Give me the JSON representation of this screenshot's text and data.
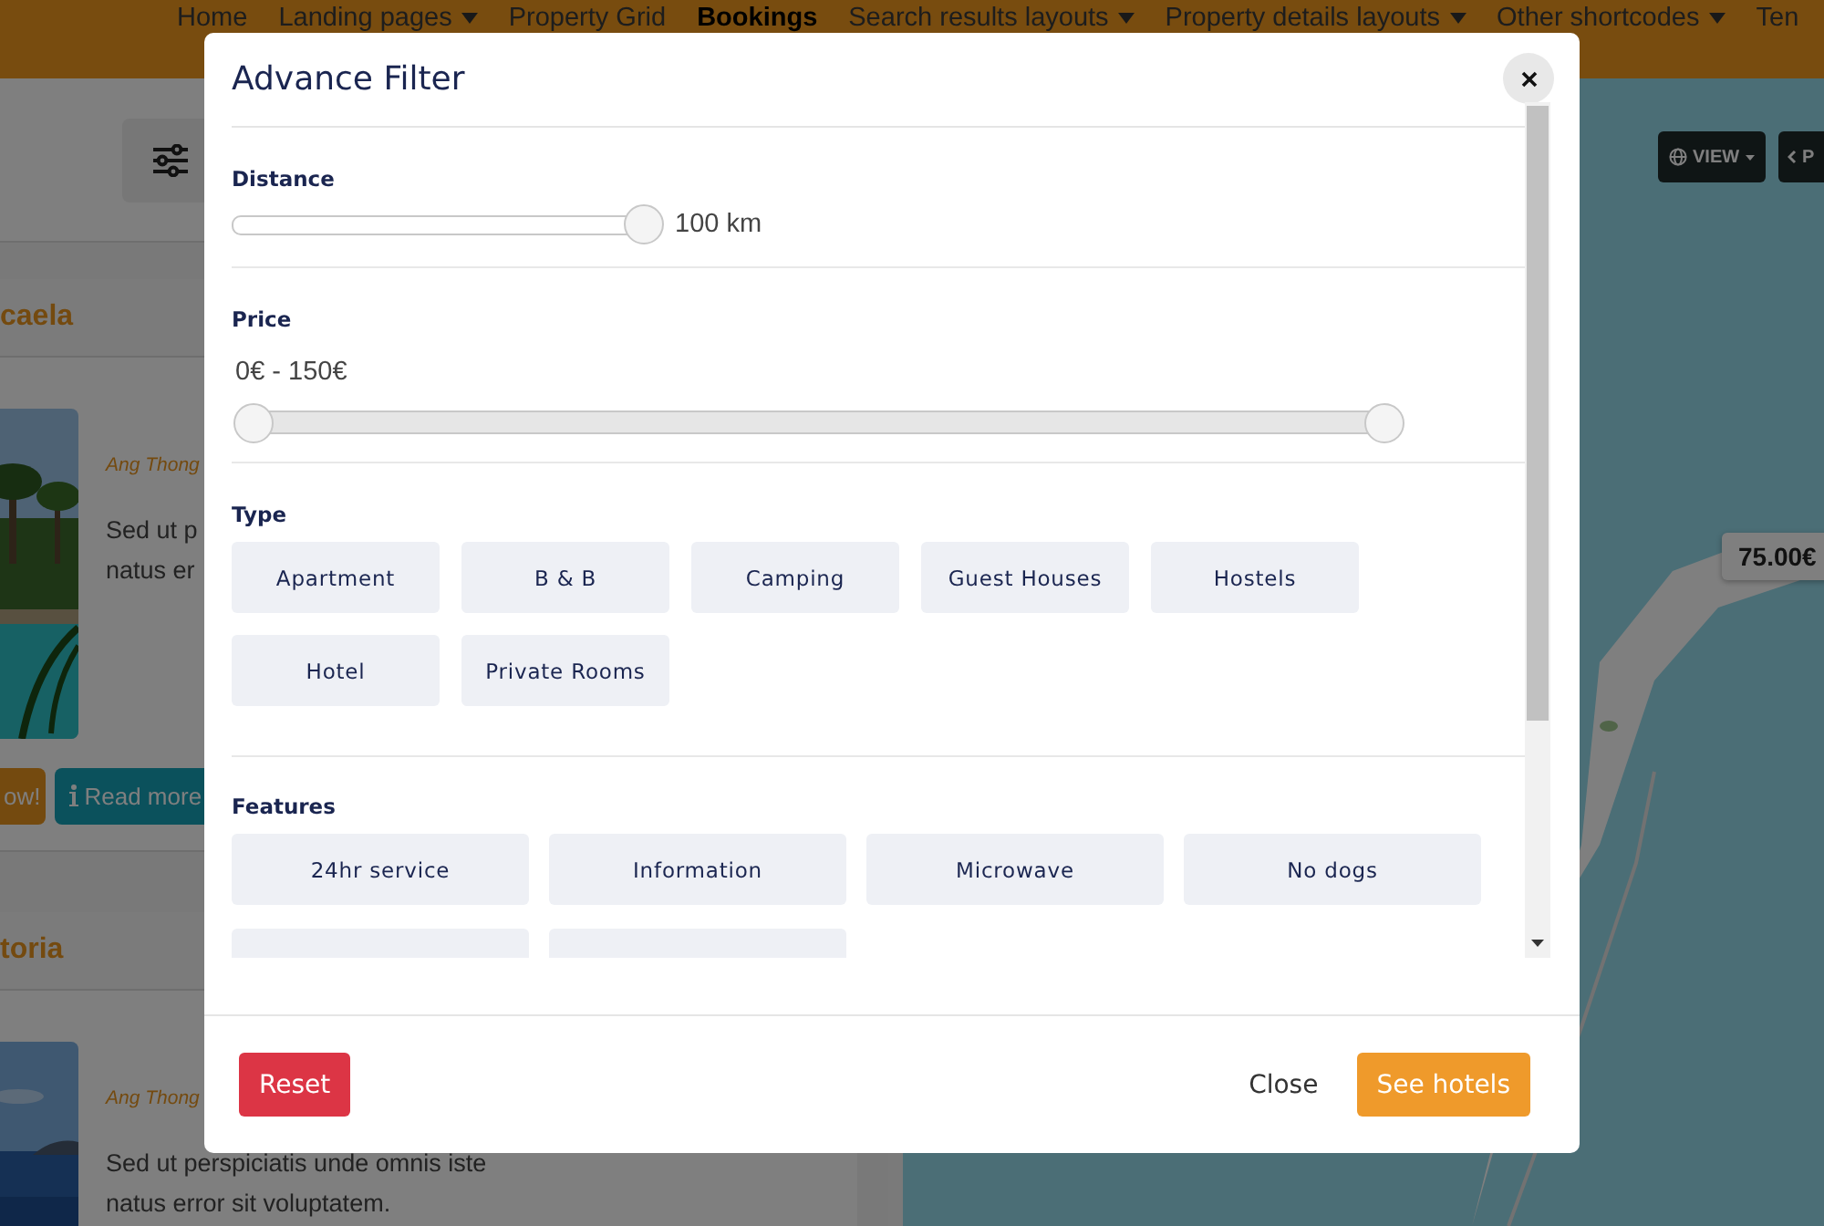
{
  "nav": {
    "items": [
      {
        "label": "Home",
        "has_menu": false,
        "selected": false
      },
      {
        "label": "Landing pages",
        "has_menu": true,
        "selected": false
      },
      {
        "label": "Property Grid",
        "has_menu": false,
        "selected": false
      },
      {
        "label": "Bookings",
        "has_menu": false,
        "selected": true
      },
      {
        "label": "Search results layouts",
        "has_menu": true,
        "selected": false
      },
      {
        "label": "Property details layouts",
        "has_menu": true,
        "selected": false
      },
      {
        "label": "Other shortcodes",
        "has_menu": true,
        "selected": false
      },
      {
        "label": "Ten",
        "has_menu": false,
        "selected": false
      }
    ]
  },
  "listings": [
    {
      "title": "caela",
      "location": "Ang Thong",
      "text_lines": [
        "Sed ut p",
        "natus er"
      ],
      "buttons": [
        {
          "label": "ow!",
          "kind": "book"
        },
        {
          "label": "Read more",
          "kind": "info"
        }
      ]
    },
    {
      "title": "toria",
      "location": "Ang Thong",
      "text_lines": [
        "Sed ut perspiciatis unde omnis iste",
        "natus error sit voluptatem."
      ]
    }
  ],
  "map": {
    "view_button": "VIEW",
    "prev_button": "P",
    "price_marker": "75.00€"
  },
  "modal": {
    "title": "Advance Filter",
    "sections": [
      {
        "kind": "slider",
        "label": "Distance",
        "level": 1,
        "reading": "100 km"
      },
      {
        "kind": "range",
        "label": "Price",
        "reading": "0€ - 150€",
        "handles": [
          {
            "level": 0
          },
          {
            "level": 1
          }
        ]
      },
      {
        "kind": "chips",
        "label": "Type",
        "options": [
          {
            "label": "Apartment",
            "selected": false
          },
          {
            "label": "B & B",
            "selected": false
          },
          {
            "label": "Camping",
            "selected": false
          },
          {
            "label": "Guest Houses",
            "selected": false
          },
          {
            "label": "Hostels",
            "selected": false
          },
          {
            "label": "Hotel",
            "selected": false
          },
          {
            "label": "Private Rooms",
            "selected": false
          }
        ]
      },
      {
        "kind": "wide_chips",
        "label": "Features",
        "options": [
          {
            "label": "24hr service",
            "selected": false
          },
          {
            "label": "Information",
            "selected": false
          },
          {
            "label": "Microwave",
            "selected": false
          },
          {
            "label": "No dogs",
            "selected": false
          },
          {
            "selected": false
          },
          {
            "selected": false
          }
        ]
      }
    ],
    "footer": {
      "reset": "Reset",
      "close": "Close",
      "submit": "See hotels"
    }
  }
}
